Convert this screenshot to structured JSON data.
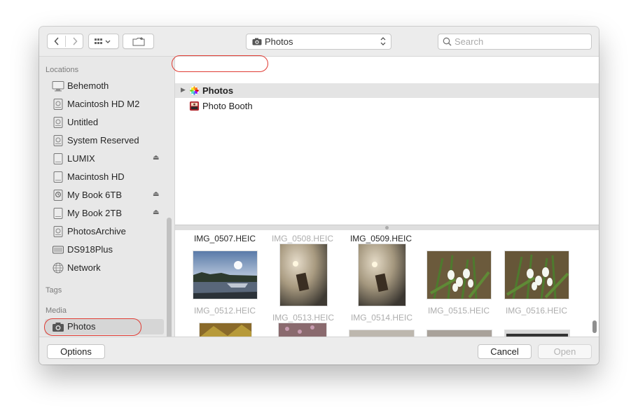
{
  "toolbar": {
    "location_popup": "Photos",
    "search_placeholder": "Search"
  },
  "sidebar": {
    "sections": {
      "locations": "Locations",
      "tags": "Tags",
      "media": "Media"
    },
    "locations": [
      {
        "label": "Behemoth",
        "icon": "computer-icon",
        "eject": false
      },
      {
        "label": "Macintosh HD M2",
        "icon": "internal-disk-icon",
        "eject": false
      },
      {
        "label": "Untitled",
        "icon": "internal-disk-icon",
        "eject": false
      },
      {
        "label": "System Reserved",
        "icon": "internal-disk-icon",
        "eject": false
      },
      {
        "label": "LUMIX",
        "icon": "external-disk-icon",
        "eject": true
      },
      {
        "label": "Macintosh HD",
        "icon": "external-disk-icon",
        "eject": false
      },
      {
        "label": "My Book 6TB",
        "icon": "time-machine-disk-icon",
        "eject": true
      },
      {
        "label": "My Book 2TB",
        "icon": "external-disk-icon",
        "eject": true
      },
      {
        "label": "PhotosArchive",
        "icon": "internal-disk-icon",
        "eject": false
      },
      {
        "label": "DS918Plus",
        "icon": "nas-server-icon",
        "eject": false
      },
      {
        "label": "Network",
        "icon": "network-globe-icon",
        "eject": false
      }
    ],
    "media": [
      {
        "label": "Photos",
        "icon": "camera-icon",
        "selected": true
      }
    ]
  },
  "list": {
    "rows": [
      {
        "label": "Photos",
        "icon": "photos-app-icon",
        "selected": true,
        "disclosure": true
      },
      {
        "label": "Photo Booth",
        "icon": "photo-booth-icon",
        "selected": false,
        "disclosure": false
      }
    ]
  },
  "gallery": {
    "top_row_names": [
      {
        "name": "IMG_0507.HEIC",
        "dimmed": false
      },
      {
        "name": "IMG_0508.HEIC",
        "dimmed": true
      },
      {
        "name": "IMG_0509.HEIC",
        "dimmed": false
      }
    ],
    "middle_row_names": [
      {
        "name": "IMG_0512.HEIC",
        "dimmed": true
      },
      {
        "name": "IMG_0513.HEIC",
        "dimmed": true
      },
      {
        "name": "IMG_0514.HEIC",
        "dimmed": true
      },
      {
        "name": "IMG_0515.HEIC",
        "dimmed": true
      },
      {
        "name": "IMG_0516.HEIC",
        "dimmed": true
      }
    ]
  },
  "buttons": {
    "options": "Options",
    "cancel": "Cancel",
    "open": "Open"
  },
  "colors": {
    "highlight_ring": "#e03c34",
    "selection": "#d6d6d6"
  }
}
